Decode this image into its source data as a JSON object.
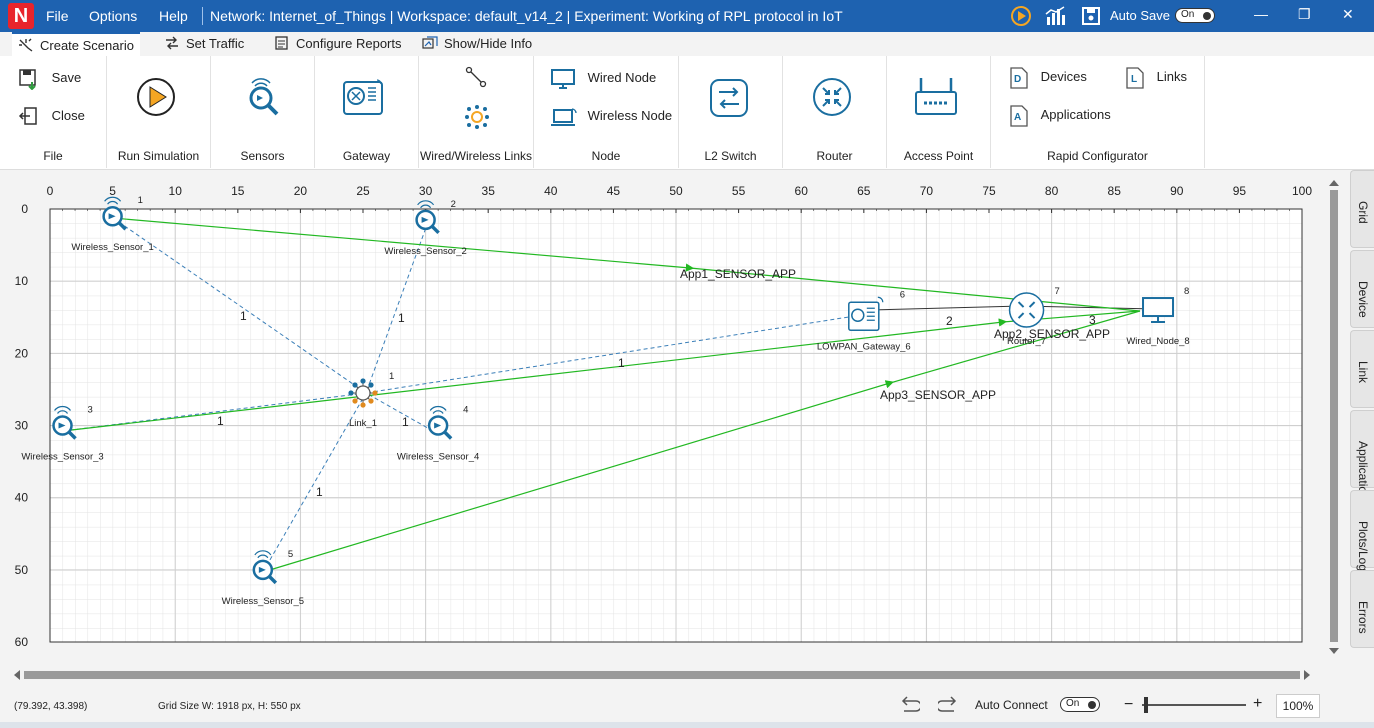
{
  "titlebar": {
    "logo": "N",
    "menu": [
      "File",
      "Options",
      "Help"
    ],
    "title": "Network: Internet_of_Things | Workspace: default_v14_2 | Experiment: Working of RPL protocol in IoT",
    "auto_save_label": "Auto Save",
    "auto_save_state": "On",
    "bg_color": "#1e62b0"
  },
  "tabs": [
    "Create Scenario",
    "Set Traffic",
    "Configure Reports",
    "Show/Hide Info"
  ],
  "ribbon": {
    "file": {
      "save": "Save",
      "close": "Close",
      "label": "File"
    },
    "run": {
      "label": "Run Simulation"
    },
    "sensors": {
      "label": "Sensors"
    },
    "gateway": {
      "label": "Gateway"
    },
    "links": {
      "label": "Wired/Wireless Links"
    },
    "node": {
      "wired": "Wired Node",
      "wireless": "Wireless Node",
      "label": "Node"
    },
    "l2switch": {
      "label": "L2 Switch"
    },
    "router": {
      "label": "Router"
    },
    "ap": {
      "label": "Access Point"
    },
    "rapid": {
      "devices": "Devices",
      "applications": "Applications",
      "links": "Links",
      "label": "Rapid Configurator"
    }
  },
  "grid": {
    "x_ticks": [
      "0",
      "5",
      "10",
      "15",
      "20",
      "25",
      "30",
      "35",
      "40",
      "45",
      "50",
      "55",
      "60",
      "65",
      "70",
      "75",
      "80",
      "85",
      "90",
      "95",
      "100"
    ],
    "y_ticks": [
      "0",
      "10",
      "20",
      "30",
      "40",
      "50",
      "60"
    ]
  },
  "devices": [
    {
      "name": "Wireless_Sensor_1",
      "id": "1",
      "type": "sensor",
      "x": 5,
      "y": 1
    },
    {
      "name": "Wireless_Sensor_2",
      "id": "2",
      "type": "sensor",
      "x": 30,
      "y": 1.5
    },
    {
      "name": "Wireless_Sensor_3",
      "id": "3",
      "type": "sensor",
      "x": 1,
      "y": 30
    },
    {
      "name": "Wireless_Sensor_4",
      "id": "4",
      "type": "sensor",
      "x": 31,
      "y": 30
    },
    {
      "name": "Wireless_Sensor_5",
      "id": "5",
      "type": "sensor",
      "x": 17,
      "y": 50
    },
    {
      "name": "LOWPAN_Gateway_6",
      "id": "6",
      "type": "gateway",
      "x": 65,
      "y": 15
    },
    {
      "name": "Router_7",
      "id": "7",
      "type": "router",
      "x": 78,
      "y": 14
    },
    {
      "name": "Wired_Node_8",
      "id": "8",
      "type": "wired",
      "x": 88.5,
      "y": 14
    },
    {
      "name": "Link_1",
      "id": "1",
      "type": "link",
      "x": 25,
      "y": 25.5
    }
  ],
  "link_labels": [
    "1",
    "1",
    "1",
    "1",
    "1",
    "1",
    "2",
    "3"
  ],
  "applications": [
    "App1_SENSOR_APP",
    "App2_SENSOR_APP",
    "App3_SENSOR_APP"
  ],
  "dock_tabs": [
    "Grid",
    "Device",
    "Link",
    "Application",
    "Plots/Logs",
    "Errors"
  ],
  "status": {
    "coords": "(79.392, 43.398)",
    "grid_size": "Grid Size W: 1918 px, H: 550 px",
    "auto_connect_label": "Auto Connect",
    "auto_connect_state": "On",
    "zoom": "100%"
  }
}
